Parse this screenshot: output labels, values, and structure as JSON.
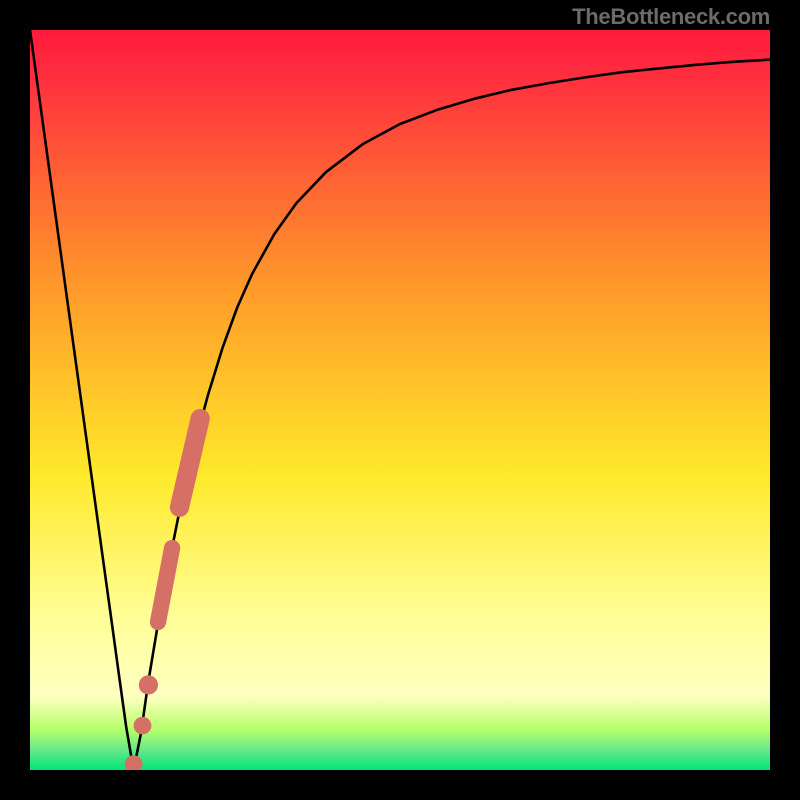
{
  "watermark": "TheBottleneck.com",
  "colors": {
    "top": "#ff1a3a",
    "red": "#ff2a3f",
    "orange": "#ff9a2a",
    "yellow": "#ffe92a",
    "pale": "#ffff9a",
    "lightgreen": "#b6ff6a",
    "green": "#00e676",
    "curve": "#000000",
    "marker_fill": "#d67066",
    "marker_stroke": "#b6574e",
    "frame": "#000000"
  },
  "chart_data": {
    "type": "line",
    "title": "",
    "xlabel": "",
    "ylabel": "",
    "xlim": [
      0,
      100
    ],
    "ylim": [
      0,
      100
    ],
    "grid": false,
    "legend": false,
    "series": [
      {
        "name": "bottleneck-curve",
        "x": [
          0,
          2,
          4,
          6,
          8,
          10,
          11,
          12,
          13,
          14,
          15,
          16,
          18,
          20,
          22,
          24,
          26,
          28,
          30,
          33,
          36,
          40,
          45,
          50,
          55,
          60,
          65,
          70,
          75,
          80,
          85,
          90,
          95,
          100
        ],
        "y": [
          100,
          85.5,
          71,
          56.5,
          42,
          27.5,
          20.3,
          13,
          5.8,
          0,
          5,
          12,
          24,
          34,
          43,
          50.5,
          57,
          62.5,
          67,
          72.4,
          76.6,
          80.8,
          84.6,
          87.3,
          89.2,
          90.7,
          91.9,
          92.8,
          93.6,
          94.3,
          94.8,
          95.3,
          95.7,
          96
        ]
      }
    ],
    "markers": [
      {
        "name": "segment-high",
        "x1": 20.2,
        "y1": 35.5,
        "x2": 23.0,
        "y2": 47.5,
        "width": 2.6
      },
      {
        "name": "segment-mid",
        "x1": 17.3,
        "y1": 20.0,
        "x2": 19.2,
        "y2": 30.0,
        "width": 2.2
      },
      {
        "name": "dot-a",
        "cx": 15.2,
        "cy": 6.0,
        "r": 1.2
      },
      {
        "name": "dot-b",
        "cx": 16.0,
        "cy": 11.5,
        "r": 1.3
      },
      {
        "name": "dot-min",
        "cx": 14.0,
        "cy": 0.8,
        "r": 1.2
      }
    ]
  }
}
